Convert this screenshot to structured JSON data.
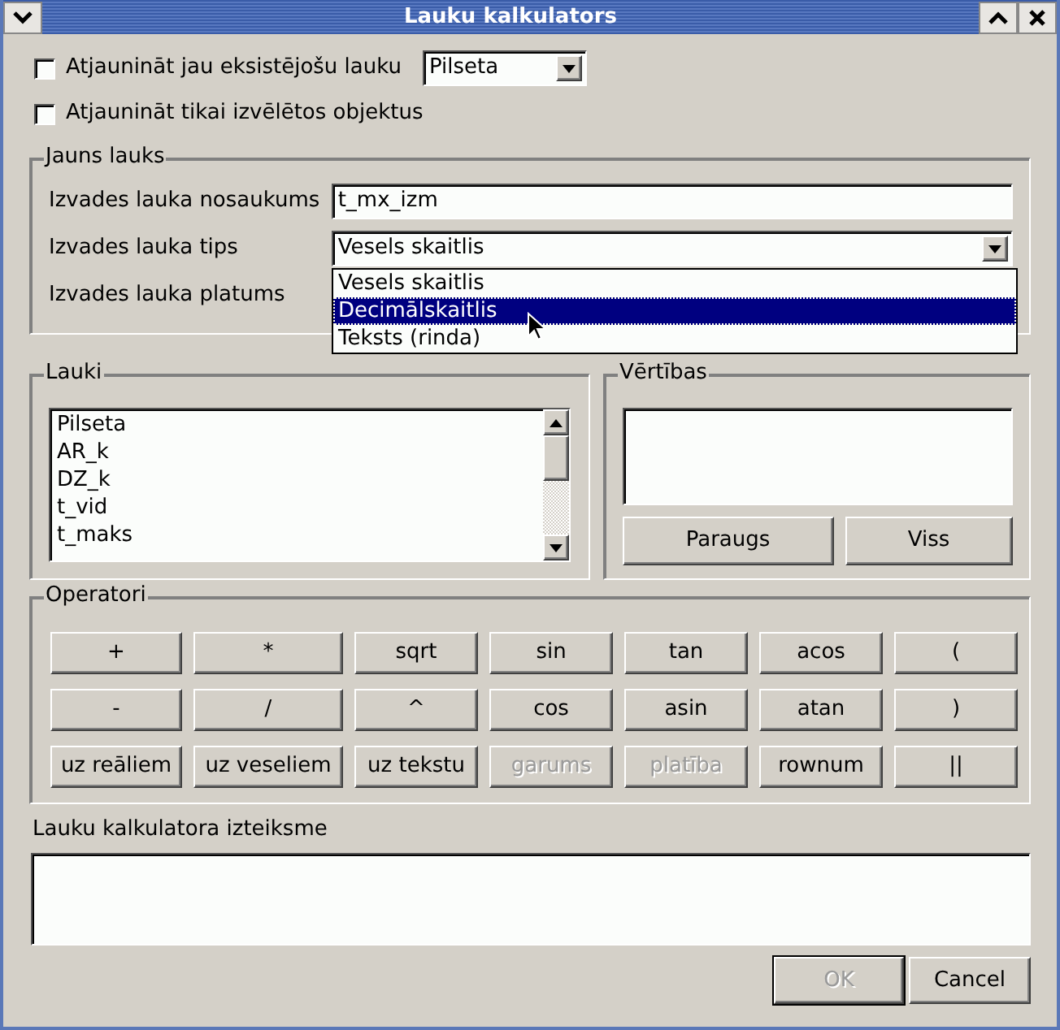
{
  "window": {
    "title": "Lauku kalkulators"
  },
  "options": [
    {
      "label": "Atjaunināt jau eksistējošu lauku",
      "checked": false,
      "combo": "Pilseta"
    },
    {
      "label": "Atjaunināt tikai izvēlētos objektus",
      "checked": false
    }
  ],
  "new_field": {
    "title": "Jauns lauks",
    "rows": [
      {
        "label": "Izvades lauka nosaukums",
        "kind": "text",
        "value": "t_mx_izm"
      },
      {
        "label": "Izvades lauka tips",
        "kind": "combo",
        "value": "Vesels skaitlis"
      },
      {
        "label": "Izvades lauka platums",
        "kind": "covered"
      }
    ],
    "popup": [
      {
        "label": "Vesels skaitlis",
        "selected": false
      },
      {
        "label": "Decimālskaitlis",
        "selected": true
      },
      {
        "label": "Teksts (rinda)",
        "selected": false
      }
    ]
  },
  "fields": {
    "title": "Lauki",
    "items": [
      "Pilseta",
      "AR_k",
      "DZ_k",
      "t_vid",
      "t_maks"
    ]
  },
  "values": {
    "title": "Vērtības",
    "buttons": [
      "Paraugs",
      "Viss"
    ]
  },
  "operators": {
    "title": "Operatori",
    "rows": [
      [
        {
          "label": "+",
          "disabled": false
        },
        {
          "label": "*",
          "disabled": false
        },
        {
          "label": "sqrt",
          "disabled": false
        },
        {
          "label": "sin",
          "disabled": false
        },
        {
          "label": "tan",
          "disabled": false
        },
        {
          "label": "acos",
          "disabled": false
        },
        {
          "label": "(",
          "disabled": false
        }
      ],
      [
        {
          "label": "-",
          "disabled": false
        },
        {
          "label": "/",
          "disabled": false
        },
        {
          "label": "^",
          "disabled": false
        },
        {
          "label": "cos",
          "disabled": false
        },
        {
          "label": "asin",
          "disabled": false
        },
        {
          "label": "atan",
          "disabled": false
        },
        {
          "label": ")",
          "disabled": false
        }
      ],
      [
        {
          "label": "uz reāliem",
          "disabled": false
        },
        {
          "label": "uz veseliem",
          "disabled": false
        },
        {
          "label": "uz tekstu",
          "disabled": false
        },
        {
          "label": "garums",
          "disabled": true
        },
        {
          "label": "platība",
          "disabled": true
        },
        {
          "label": "rownum",
          "disabled": false
        },
        {
          "label": "||",
          "disabled": false
        }
      ]
    ]
  },
  "expression": {
    "label": "Lauku kalkulatora izteiksme"
  },
  "footer": [
    {
      "label": "OK",
      "disabled": true
    },
    {
      "label": "Cancel",
      "disabled": false
    }
  ]
}
